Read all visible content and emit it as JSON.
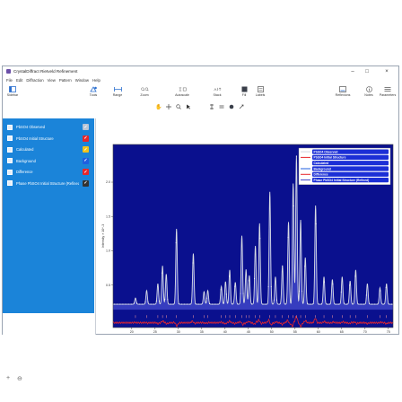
{
  "window": {
    "title": "CrystalDiffract Rietveld Refinement"
  },
  "menu": [
    "File",
    "Edit",
    "Diffraction",
    "View",
    "Pattern",
    "Window",
    "Help"
  ],
  "toolbar": {
    "sidebar": "Sidebar",
    "tools": "Tools",
    "range": "Range",
    "zoom": "Zoom",
    "autoscale": "Autoscale",
    "stack": "Stack",
    "fill": "Fill",
    "labels": "Labels",
    "reflexions": "Reflexions",
    "notes": "Notes",
    "parameters": "Parameters"
  },
  "sidebar": {
    "items": [
      {
        "label": "PbSO4 Observed",
        "check_color": "#b8c4d6",
        "checked": true
      },
      {
        "label": "PbSO4 Initial Structure",
        "check_color": "#e8262b",
        "checked": true
      },
      {
        "label": "Calculated",
        "check_color": "#f1c21b",
        "checked": true
      },
      {
        "label": "Background",
        "check_color": "#1f5fe0",
        "checked": true
      },
      {
        "label": "Difference",
        "check_color": "#e8262b",
        "checked": true
      },
      {
        "label": "Phase PbSO4 Initial Structure (Refined)",
        "check_color": "#333333",
        "checked": true
      }
    ],
    "add_button": "+",
    "remove_button": "⊖"
  },
  "colors": {
    "accent": "#1b84d9",
    "plot_bg": "#0a108e",
    "observed": "#d8dce4",
    "calculated": "#ffffff",
    "difference": "#e8262b"
  },
  "chart_data": {
    "type": "line",
    "xlabel": "2θ (°)",
    "ylabel": "Intensity × 10^-3",
    "xlim": [
      16,
      76
    ],
    "ylim": [
      -0.12,
      2.55
    ],
    "xticks": [
      "20",
      "25",
      "30",
      "35",
      "40",
      "45",
      "50",
      "55",
      "60",
      "65",
      "70",
      "75"
    ],
    "yticks": [
      "0.5",
      "1.0",
      "1.5",
      "2.0"
    ],
    "legend_position": "top-right",
    "legend": [
      "PbSO4 Observed",
      "PbSO4 Initial Structure",
      "Calculated",
      "Background",
      "Difference",
      "Phase PbSO4 Initial Structure (Refined)"
    ],
    "background_level": 0.22,
    "peaks": [
      {
        "x": 20.8,
        "y": 0.31
      },
      {
        "x": 23.2,
        "y": 0.42
      },
      {
        "x": 25.6,
        "y": 0.52
      },
      {
        "x": 26.6,
        "y": 0.78
      },
      {
        "x": 27.4,
        "y": 0.66
      },
      {
        "x": 29.6,
        "y": 1.32
      },
      {
        "x": 33.2,
        "y": 0.96
      },
      {
        "x": 35.5,
        "y": 0.4
      },
      {
        "x": 36.3,
        "y": 0.42
      },
      {
        "x": 39.2,
        "y": 0.48
      },
      {
        "x": 40.1,
        "y": 0.55
      },
      {
        "x": 41.0,
        "y": 0.72
      },
      {
        "x": 42.2,
        "y": 0.54
      },
      {
        "x": 43.6,
        "y": 1.22
      },
      {
        "x": 44.5,
        "y": 0.72
      },
      {
        "x": 45.2,
        "y": 0.64
      },
      {
        "x": 46.5,
        "y": 1.07
      },
      {
        "x": 47.4,
        "y": 1.4
      },
      {
        "x": 49.6,
        "y": 1.86
      },
      {
        "x": 50.8,
        "y": 0.62
      },
      {
        "x": 52.3,
        "y": 0.78
      },
      {
        "x": 53.6,
        "y": 1.42
      },
      {
        "x": 54.6,
        "y": 1.98
      },
      {
        "x": 55.3,
        "y": 2.38
      },
      {
        "x": 56.2,
        "y": 1.45
      },
      {
        "x": 57.2,
        "y": 0.9
      },
      {
        "x": 59.4,
        "y": 1.66
      },
      {
        "x": 61.2,
        "y": 0.62
      },
      {
        "x": 63.0,
        "y": 0.58
      },
      {
        "x": 65.1,
        "y": 0.62
      },
      {
        "x": 66.8,
        "y": 0.56
      },
      {
        "x": 68.0,
        "y": 0.72
      },
      {
        "x": 70.5,
        "y": 0.52
      },
      {
        "x": 73.2,
        "y": 0.46
      },
      {
        "x": 74.6,
        "y": 0.52
      }
    ]
  }
}
